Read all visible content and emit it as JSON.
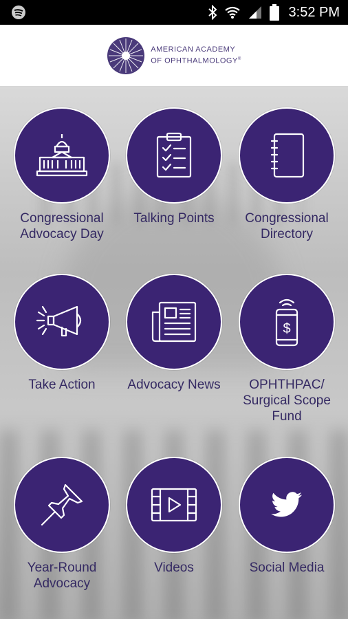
{
  "status_bar": {
    "time": "3:52 PM",
    "icons": [
      "spotify-icon",
      "bluetooth-icon",
      "wifi-icon",
      "signal-icon",
      "battery-icon"
    ]
  },
  "header": {
    "org_line1": "AMERICAN ACADEMY",
    "org_line2": "OF OPHTHALMOLOGY",
    "trademark": "®"
  },
  "colors": {
    "primary": "#3b2473",
    "label": "#352a63"
  },
  "tiles": [
    {
      "line1": "Congressional",
      "line2": "Advocacy Day",
      "line3": "",
      "icon": "capitol-icon"
    },
    {
      "line1": "Talking Points",
      "line2": "",
      "line3": "",
      "icon": "clipboard-checklist-icon"
    },
    {
      "line1": "Congressional",
      "line2": "Directory",
      "line3": "",
      "icon": "notebook-icon"
    },
    {
      "line1": "Take Action",
      "line2": "",
      "line3": "",
      "icon": "megaphone-icon"
    },
    {
      "line1": "Advocacy News",
      "line2": "",
      "line3": "",
      "icon": "newspaper-icon"
    },
    {
      "line1": "OPHTHPAC/",
      "line2": "Surgical Scope",
      "line3": "Fund",
      "icon": "mobile-payment-icon"
    },
    {
      "line1": "Year-Round",
      "line2": "Advocacy",
      "line3": "",
      "icon": "pushpin-icon"
    },
    {
      "line1": "Videos",
      "line2": "",
      "line3": "",
      "icon": "video-film-icon"
    },
    {
      "line1": "Social Media",
      "line2": "",
      "line3": "",
      "icon": "twitter-bird-icon"
    }
  ]
}
